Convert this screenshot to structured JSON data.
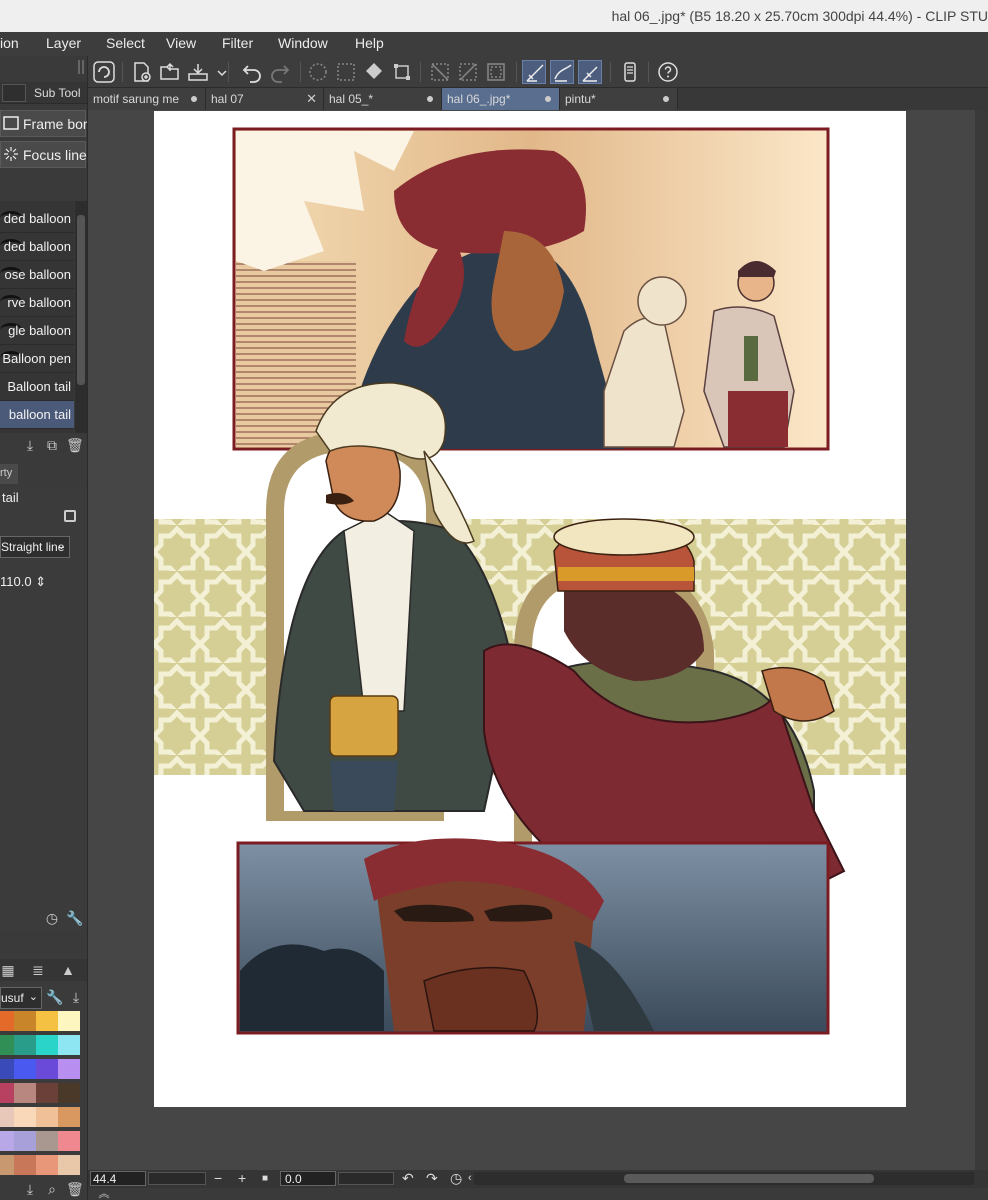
{
  "window": {
    "title": "hal 06_.jpg* (B5 18.20 x 25.70cm 300dpi 44.4%)  - CLIP STU"
  },
  "menu": [
    "ion",
    "Layer",
    "Select",
    "View",
    "Filter",
    "Window",
    "Help"
  ],
  "tabs": [
    {
      "label": "motif sarung me",
      "mark": "dot"
    },
    {
      "label": "hal 07",
      "mark": "close"
    },
    {
      "label": "hal 05_*",
      "mark": "dot"
    },
    {
      "label": "hal 06_.jpg*",
      "mark": "dot",
      "active": true
    },
    {
      "label": "pintu*",
      "mark": "dot"
    }
  ],
  "left_panel": {
    "sub_tool_tab": "Sub Tool",
    "tool_buttons": [
      "Frame bor",
      "Focus line"
    ],
    "sub_tools": [
      {
        "label": "ded balloon"
      },
      {
        "label": "ded balloon"
      },
      {
        "label": "ose balloon"
      },
      {
        "label": "rve balloon"
      },
      {
        "label": "gle balloon"
      },
      {
        "label": "Balloon pen"
      },
      {
        "label": "Balloon tail"
      },
      {
        "label": "balloon tail",
        "selected": true
      }
    ],
    "property_tab": "rty",
    "property": {
      "tool_name": "tail",
      "line_type": "Straight line",
      "value": "110.0"
    },
    "color_set_name": "usuf"
  },
  "palette": [
    [
      "#e46a2a",
      "#c9852a",
      "#f5c143",
      "#fdf6c0"
    ],
    [
      "#2f8f55",
      "#2a9c8a",
      "#2ad4c8",
      "#8ee6f3"
    ],
    [
      "#3a4ab8",
      "#4a5af0",
      "#6a4ad8",
      "#b88ef0"
    ],
    [
      "#b84060",
      "#b88880",
      "#6a4038",
      "#4a3828"
    ],
    [
      "#e8c8b8",
      "#f8d8b8",
      "#f0c098",
      "#d89860"
    ],
    [
      "#b8a8e8",
      "#a8a0d8",
      "#a89890",
      "#f08890"
    ],
    [
      "#c89870",
      "#c87858",
      "#e89878",
      "#e8c8a8"
    ]
  ],
  "status": {
    "zoom": "44.4",
    "rotation": "0.0"
  },
  "colors": {
    "accent_selected": "#4c5d7d",
    "panel_border": "#7a1c22",
    "pattern_bg": "#d5cf96"
  }
}
